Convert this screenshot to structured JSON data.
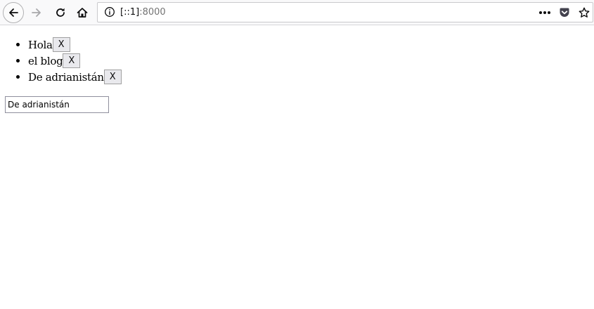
{
  "browser": {
    "url_host": "[::1]",
    "url_port": ":8000",
    "icons": [
      "back-arrow-icon",
      "forward-arrow-icon",
      "reload-icon",
      "home-icon",
      "info-icon",
      "page-actions-menu-icon",
      "pocket-icon",
      "bookmark-star-icon"
    ]
  },
  "list": {
    "items": [
      {
        "text": "Hola",
        "button": "X"
      },
      {
        "text": "el blog",
        "button": "X"
      },
      {
        "text": "De adrianistán",
        "button": "X"
      }
    ]
  },
  "input": {
    "value": "De adrianistán"
  },
  "colors": {
    "toolbar_bg": "#f9f9fa",
    "button_bg": "#e9e9ed",
    "pocket": "#42414d"
  }
}
